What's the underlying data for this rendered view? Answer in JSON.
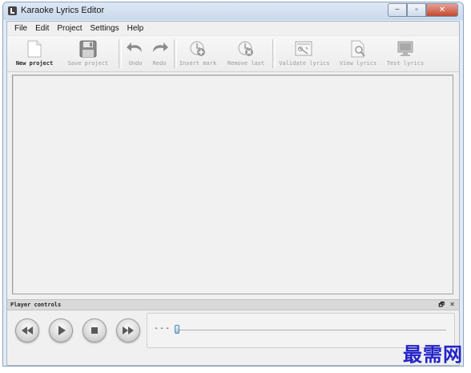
{
  "window": {
    "title": "Karaoke Lyrics Editor",
    "icon": "karaoke-note-icon",
    "minimize_glyph": "−",
    "maximize_glyph": "▫",
    "close_glyph": "✕"
  },
  "menubar": {
    "items": [
      {
        "label": "File"
      },
      {
        "label": "Edit"
      },
      {
        "label": "Project"
      },
      {
        "label": "Settings"
      },
      {
        "label": "Help"
      }
    ]
  },
  "toolbar": {
    "buttons": [
      {
        "label": "New project",
        "icon": "new-document-icon",
        "enabled": true
      },
      {
        "label": "Save project",
        "icon": "floppy-disk-icon",
        "enabled": false
      },
      {
        "label": "Undo",
        "icon": "undo-arrow-icon",
        "enabled": false
      },
      {
        "label": "Redo",
        "icon": "redo-arrow-icon",
        "enabled": false
      },
      {
        "label": "Insert mark",
        "icon": "insert-mark-icon",
        "enabled": false
      },
      {
        "label": "Remove last",
        "icon": "remove-mark-icon",
        "enabled": false
      },
      {
        "label": "Validate lyrics",
        "icon": "validate-lyrics-icon",
        "enabled": false
      },
      {
        "label": "View lyrics",
        "icon": "view-lyrics-icon",
        "enabled": false
      },
      {
        "label": "Test lyrics",
        "icon": "test-lyrics-monitor-icon",
        "enabled": false
      }
    ]
  },
  "editor": {
    "content": ""
  },
  "player_dock": {
    "title": "Player controls",
    "float_glyph": "🗗",
    "close_glyph": "✕",
    "buttons": [
      {
        "name": "rewind",
        "icon": "rewind-icon"
      },
      {
        "name": "play",
        "icon": "play-icon"
      },
      {
        "name": "stop",
        "icon": "stop-icon"
      },
      {
        "name": "fast-forward",
        "icon": "fast-forward-icon"
      }
    ],
    "position_text": "---",
    "position_fraction": 0.0
  },
  "watermark": {
    "text": "最需网"
  },
  "colors": {
    "disabled_text": "#9a9a9a",
    "watermark": "#2323c8",
    "slider_thumb": "#4f86b3"
  }
}
